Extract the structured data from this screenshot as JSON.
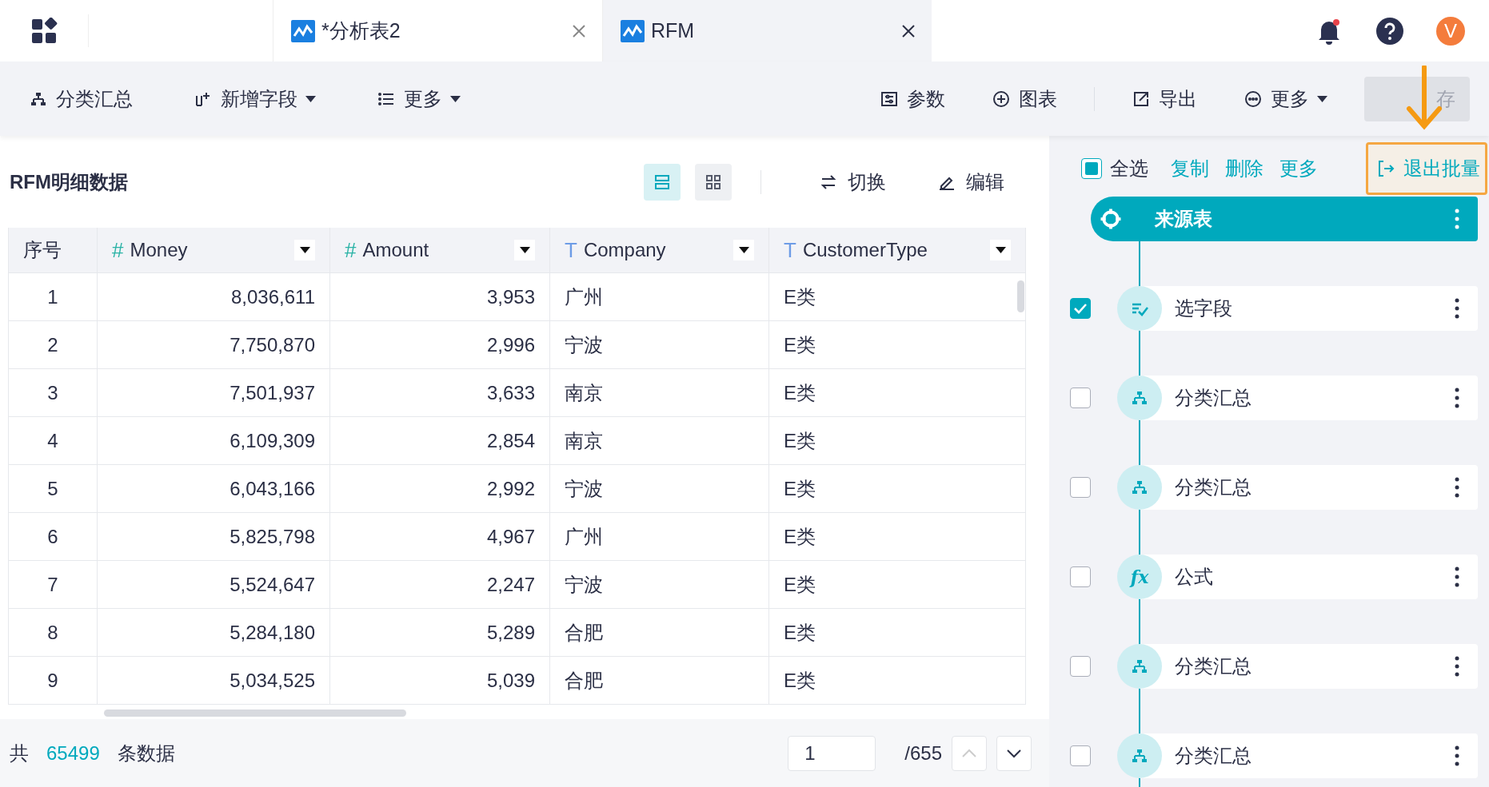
{
  "tabs": [
    {
      "title": "*分析表2",
      "selected": false
    },
    {
      "title": "RFM",
      "selected": true
    }
  ],
  "user": {
    "avatar": "V"
  },
  "toolbar": {
    "left": [
      {
        "label": "分类汇总",
        "dropdown": false
      },
      {
        "label": "新增字段",
        "dropdown": true
      },
      {
        "label": "更多",
        "dropdown": true
      }
    ],
    "right": [
      {
        "label": "参数",
        "dropdown": false
      },
      {
        "label": "图表",
        "dropdown": false
      },
      {
        "label": "导出",
        "dropdown": false
      },
      {
        "label": "更多",
        "dropdown": true
      }
    ],
    "save": {
      "label": "存",
      "disabled": true
    }
  },
  "panel": {
    "title": "RFM明细数据",
    "views": [
      {
        "kind": "rows",
        "selected": true
      },
      {
        "kind": "grid",
        "selected": false
      }
    ],
    "actions": [
      {
        "label": "切换"
      },
      {
        "label": "编辑"
      }
    ]
  },
  "table": {
    "columns": [
      {
        "label": "序号",
        "kind": "index"
      },
      {
        "label": "Money",
        "kind": "number",
        "mark": "#"
      },
      {
        "label": "Amount",
        "kind": "number",
        "mark": "#"
      },
      {
        "label": "Company",
        "kind": "text",
        "mark": "T"
      },
      {
        "label": "CustomerType",
        "kind": "text",
        "mark": "T"
      }
    ],
    "rows": [
      [
        "1",
        "8,036,611",
        "3,953",
        "广州",
        "E类"
      ],
      [
        "2",
        "7,750,870",
        "2,996",
        "宁波",
        "E类"
      ],
      [
        "3",
        "7,501,937",
        "3,633",
        "南京",
        "E类"
      ],
      [
        "4",
        "6,109,309",
        "2,854",
        "南京",
        "E类"
      ],
      [
        "5",
        "6,043,166",
        "2,992",
        "宁波",
        "E类"
      ],
      [
        "6",
        "5,825,798",
        "4,967",
        "广州",
        "E类"
      ],
      [
        "7",
        "5,524,647",
        "2,247",
        "宁波",
        "E类"
      ],
      [
        "8",
        "5,284,180",
        "5,289",
        "合肥",
        "E类"
      ],
      [
        "9",
        "5,034,525",
        "5,039",
        "合肥",
        "E类"
      ]
    ]
  },
  "footer": {
    "prefix": "共",
    "count": "65499",
    "suffix": "条数据",
    "page": "1",
    "total": "/655"
  },
  "flow": {
    "select_all": {
      "label": "全选",
      "indeterminate": true
    },
    "actions": [
      "复制",
      "删除",
      "更多"
    ],
    "exit": {
      "label": "退出批量",
      "highlighted": true
    },
    "nodes": [
      {
        "label": "来源表",
        "kind": "source"
      },
      {
        "label": "选字段",
        "kind": "select",
        "checked": true
      },
      {
        "label": "分类汇总",
        "kind": "group",
        "checked": false
      },
      {
        "label": "分类汇总",
        "kind": "group",
        "checked": false
      },
      {
        "label": "公式",
        "kind": "formula",
        "icon_text": "fx",
        "checked": false
      },
      {
        "label": "分类汇总",
        "kind": "group",
        "checked": false
      },
      {
        "label": "分类汇总",
        "kind": "group",
        "checked": false
      }
    ]
  }
}
